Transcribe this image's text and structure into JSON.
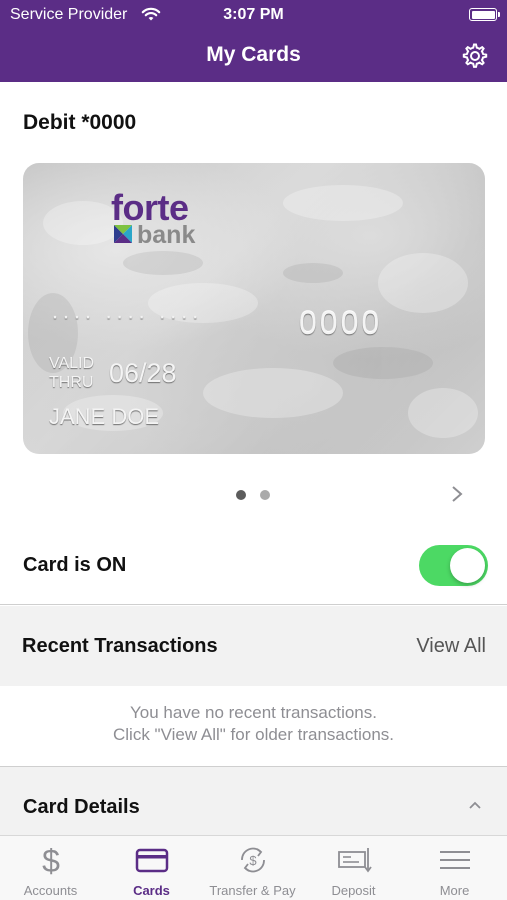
{
  "status_bar": {
    "carrier": "Service Provider",
    "time": "3:07 PM"
  },
  "nav": {
    "title": "My Cards",
    "settings_icon": "gear-icon"
  },
  "card_section": {
    "title": "Debit *0000",
    "card": {
      "brand_primary": "forte",
      "brand_secondary": "bank",
      "masked_groups": "···· ···· ····",
      "last4": "0000",
      "valid_line1": "VALID",
      "valid_line2": "THRU",
      "expiry": "06/28",
      "holder": "JANE DOE"
    },
    "pager": {
      "total": 2,
      "active_index": 0
    }
  },
  "card_status": {
    "label": "Card is ON",
    "enabled": true
  },
  "recent": {
    "title": "Recent Transactions",
    "view_all": "View All",
    "empty_line1": "You have no recent transactions.",
    "empty_line2": "Click \"View All\" for older transactions."
  },
  "details": {
    "title": "Card Details"
  },
  "tabs": [
    {
      "label": "Accounts",
      "icon": "dollar-icon",
      "active": false
    },
    {
      "label": "Cards",
      "icon": "card-icon",
      "active": true
    },
    {
      "label": "Transfer & Pay",
      "icon": "transfer-icon",
      "active": false
    },
    {
      "label": "Deposit",
      "icon": "check-deposit-icon",
      "active": false
    },
    {
      "label": "More",
      "icon": "menu-icon",
      "active": false
    }
  ],
  "colors": {
    "brand_purple": "#5b2d86",
    "toggle_green": "#4cd964",
    "inactive_tab": "#8e8e93"
  }
}
